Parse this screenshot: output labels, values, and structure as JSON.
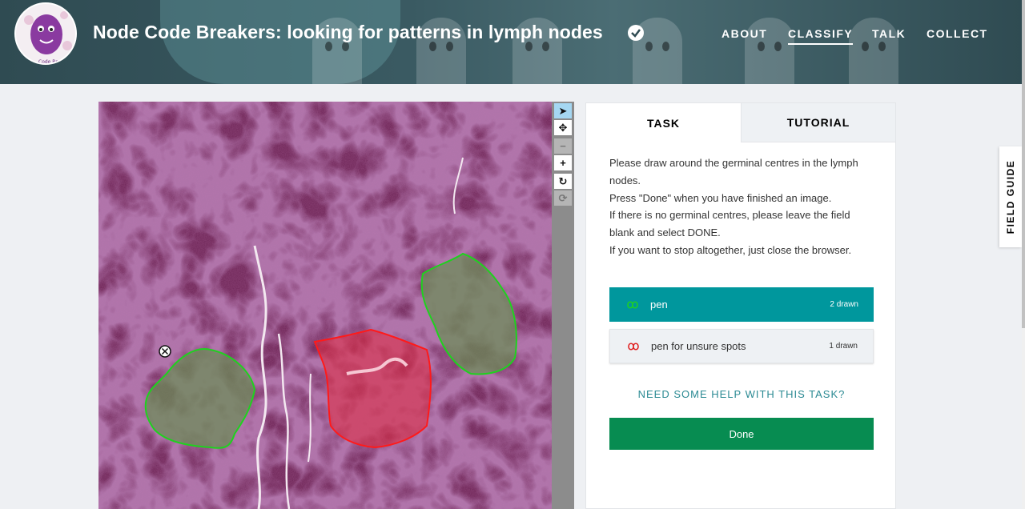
{
  "header": {
    "title": "Node Code Breakers: looking for patterns in lymph nodes",
    "logo_text": "Code Bre",
    "nav": [
      {
        "label": "ABOUT",
        "active": false
      },
      {
        "label": "CLASSIFY",
        "active": true
      },
      {
        "label": "TALK",
        "active": false
      },
      {
        "label": "COLLECT",
        "active": false
      }
    ]
  },
  "viewer": {
    "tools": [
      {
        "name": "pointer-icon",
        "glyph": "➤",
        "state": "selected"
      },
      {
        "name": "pan-icon",
        "glyph": "✥",
        "state": "normal"
      },
      {
        "name": "zoom-out-icon",
        "glyph": "−",
        "state": "disabled"
      },
      {
        "name": "zoom-in-icon",
        "glyph": "+",
        "state": "normal"
      },
      {
        "name": "rotate-icon",
        "glyph": "↻",
        "state": "normal"
      },
      {
        "name": "reset-icon",
        "glyph": "⟳",
        "state": "disabled"
      }
    ]
  },
  "task": {
    "tabs": {
      "task": "TASK",
      "tutorial": "TUTORIAL"
    },
    "instructions": [
      "Please draw around the germinal centres in the lymph nodes.",
      "Press \"Done\" when you have finished an image.",
      "If there is no germinal centres, please leave the field blank and select DONE.",
      "If you want to stop altogether, just close the browser."
    ],
    "tools": [
      {
        "label": "pen",
        "count": "2 drawn",
        "color": "#1fd11f",
        "active": true
      },
      {
        "label": "pen for unsure spots",
        "count": "1 drawn",
        "color": "#e02020",
        "active": false
      }
    ],
    "help_link": "NEED SOME HELP WITH THIS TASK?",
    "done_label": "Done"
  },
  "field_guide": "FIELD GUIDE",
  "colors": {
    "header": "#2f4b52",
    "teal": "#00979d",
    "done": "#078c51",
    "tissue": "#6b2555",
    "pen_green": "#1fd11f",
    "pen_red": "#e02020"
  }
}
